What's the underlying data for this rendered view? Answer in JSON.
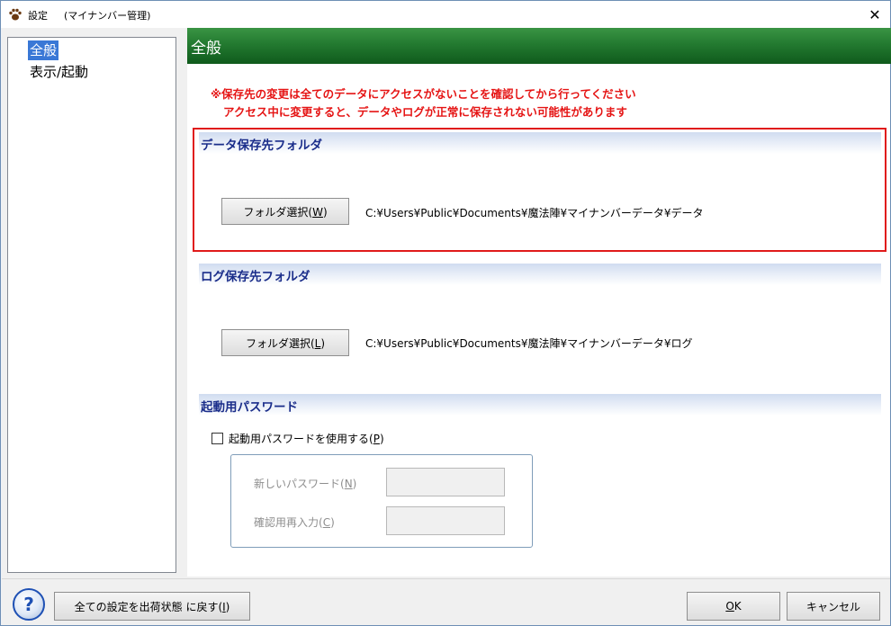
{
  "window": {
    "title": "設定",
    "subtitle": "(マイナンバー管理)",
    "close_glyph": "✕"
  },
  "tree": {
    "items": [
      {
        "label": "全般",
        "selected": true
      },
      {
        "label": "表示/起動",
        "selected": false
      }
    ]
  },
  "header": {
    "title": "全般"
  },
  "notice": {
    "line1": "※保存先の変更は全てのデータにアクセスがないことを確認してから行ってください",
    "line2": "アクセス中に変更すると、データやログが正常に保存されない可能性があります"
  },
  "data_folder": {
    "heading": "データ保存先フォルダ",
    "button_label": "フォルダ選択(",
    "button_key": "W",
    "button_close": ")",
    "path": "C:¥Users¥Public¥Documents¥魔法陣¥マイナンバーデータ¥データ"
  },
  "log_folder": {
    "heading": "ログ保存先フォルダ",
    "button_label": "フォルダ選択(",
    "button_key": "L",
    "button_close": ")",
    "path": "C:¥Users¥Public¥Documents¥魔法陣¥マイナンバーデータ¥ログ"
  },
  "password": {
    "heading": "起動用パスワード",
    "checkbox_label": "起動用パスワードを使用する(",
    "checkbox_key": "P",
    "checkbox_close": ")",
    "checked": false,
    "new_label": "新しいパスワード(",
    "new_key": "N",
    "new_close": ")",
    "new_value": "",
    "confirm_label": "確認用再入力(",
    "confirm_key": "C",
    "confirm_close": ")",
    "confirm_value": ""
  },
  "footer": {
    "help_glyph": "?",
    "reset_label": "全ての設定を出荷状態 に戻す(",
    "reset_key": "I",
    "reset_close": ")",
    "ok_key": "O",
    "ok_rest": "K",
    "cancel_label": "キャンセル"
  },
  "colors": {
    "header_green": "#237a30",
    "notice_red": "#e51414",
    "section_text": "#1a2d8a",
    "highlight_border": "#e01a1a",
    "tree_selection": "#3a78d6"
  }
}
